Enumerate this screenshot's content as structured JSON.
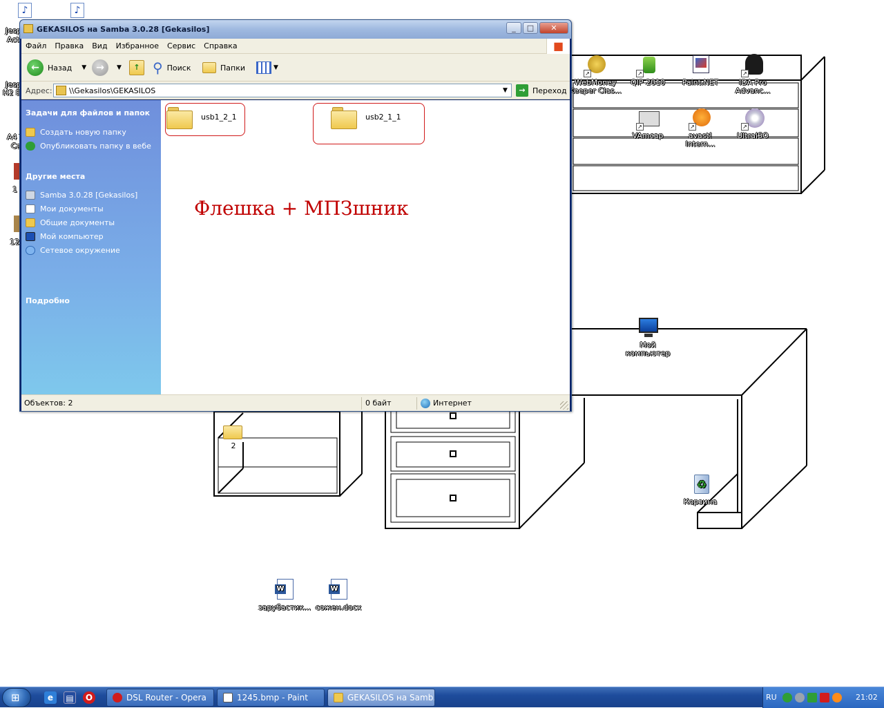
{
  "window": {
    "title": "GEKASILOS на Samba 3.0.28 [Gekasilos]",
    "controls": {
      "minimize": "_",
      "maximize": "□",
      "close": "✕"
    }
  },
  "menu": [
    "Файл",
    "Правка",
    "Вид",
    "Избранное",
    "Сервис",
    "Справка"
  ],
  "toolbar": {
    "back": "Назад",
    "search": "Поиск",
    "folders": "Папки"
  },
  "address": {
    "label": "Адрес:",
    "value": "\\\\Gekasilos\\GEKASILOS",
    "go": "Переход"
  },
  "tasks": {
    "file_tasks_title": "Задачи для файлов и папок",
    "file_tasks": [
      "Создать новую папку",
      "Опубликовать папку в вебе"
    ],
    "other_places_title": "Другие места",
    "other_places": [
      "Samba 3.0.28 [Gekasilos]",
      "Мои документы",
      "Общие документы",
      "Мой компьютер",
      "Сетевое окружение"
    ],
    "details_title": "Подробно"
  },
  "folders": [
    "usb1_2_1",
    "usb2_1_1"
  ],
  "note": "Флешка + МПЗшник",
  "status": {
    "objects": "Объектов: 2",
    "size": "0 байт",
    "zone": "Интернет"
  },
  "desktop_icons": [
    {
      "label": "WebMoney Keeper Clas...",
      "icon": "webmoney-icon"
    },
    {
      "label": "QIP 2010",
      "icon": "qip-icon"
    },
    {
      "label": "Paint.NET",
      "icon": "paintnet-icon"
    },
    {
      "label": "IDA Pro Advanc...",
      "icon": "ida-icon"
    },
    {
      "label": "VAmcap",
      "icon": "vamcap-icon"
    },
    {
      "label": "avast! Intern...",
      "icon": "avast-icon"
    },
    {
      "label": "UltraISO",
      "icon": "ultraiso-icon"
    },
    {
      "label": "Мой компьютер",
      "icon": "my-computer-icon"
    },
    {
      "label": "Корзина",
      "icon": "recycle-bin-icon"
    },
    {
      "label": "2",
      "icon": "folder-icon"
    },
    {
      "label": "зарубастик...",
      "icon": "word-doc-icon"
    },
    {
      "label": "сожен.docx",
      "icon": "word-doc-icon"
    }
  ],
  "left_cut_labels": [
    "Jesp",
    "Acti",
    "Jesp",
    "H2 E",
    "A4 T",
    "Ca",
    "1",
    "12"
  ],
  "taskbar": {
    "tasks": [
      "DSL Router - Opera",
      "1245.bmp - Paint",
      "GEKASILOS на Samb..."
    ],
    "lang": "RU",
    "clock": "21:02"
  },
  "colors": {
    "taskpane": "#7aaee8",
    "note_red": "#c00000",
    "taskbar": "#1e4c9c"
  }
}
